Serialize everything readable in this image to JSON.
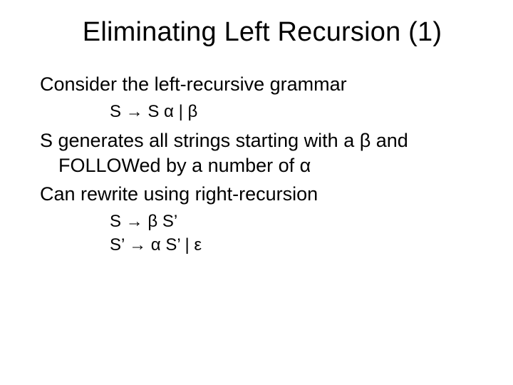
{
  "title": "Eliminating Left Recursion (1)",
  "line1": "Consider the left-recursive grammar",
  "grammar1": "S → S α | β",
  "line2": "S generates all strings starting with a β and FOLLOWed by a number of α",
  "line3": "Can rewrite using right-recursion",
  "grammar2a": "S → β S’",
  "grammar2b": "S’ → α S’ | ε"
}
